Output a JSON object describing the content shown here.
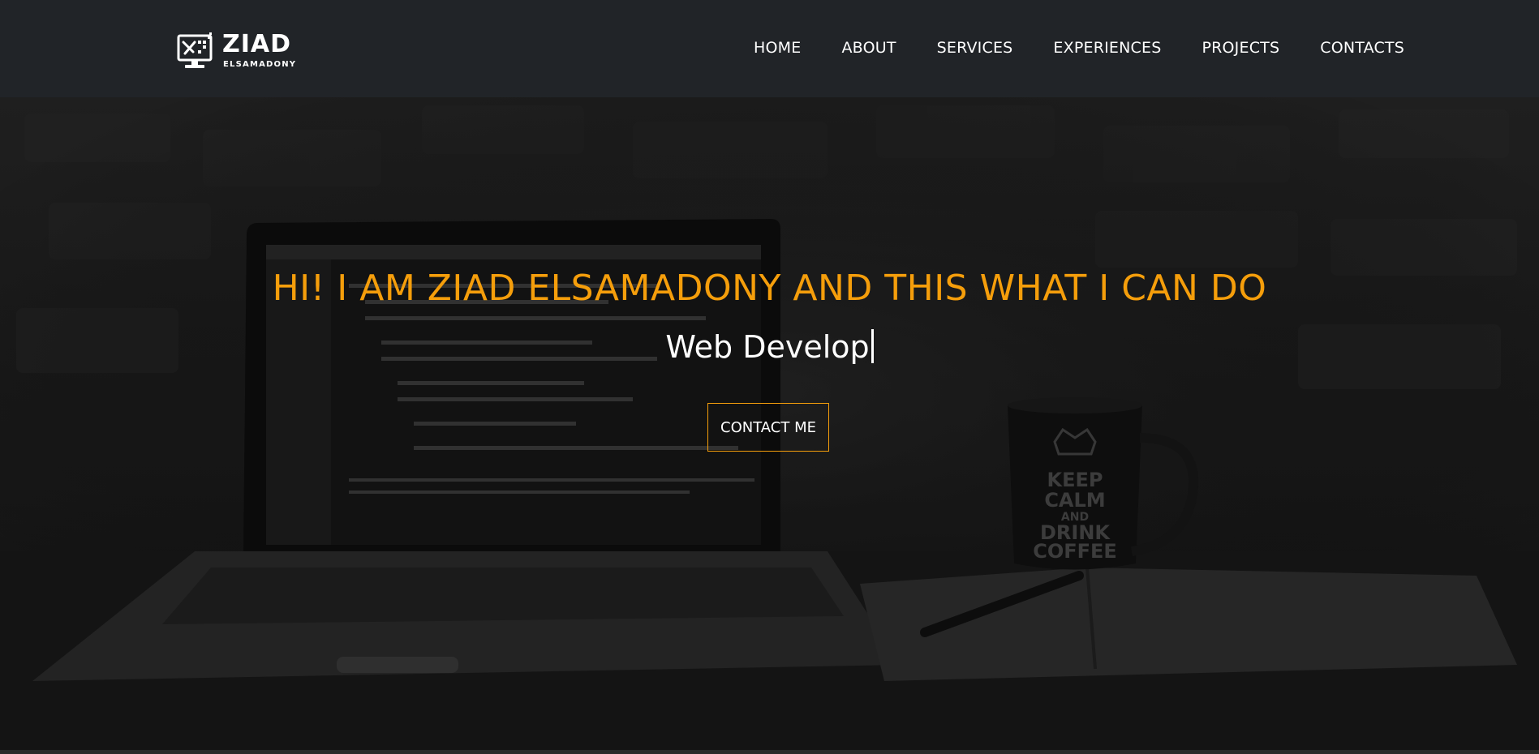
{
  "brand": {
    "name": "ZIAD",
    "subtitle": "ELSAMADONY",
    "logo_icon": "computer-tools-logo-icon"
  },
  "nav": {
    "items": [
      {
        "label": "HOME"
      },
      {
        "label": "ABOUT"
      },
      {
        "label": "SERVICES"
      },
      {
        "label": "EXPERIENCES"
      },
      {
        "label": "PROJECTS"
      },
      {
        "label": "CONTACTS"
      }
    ]
  },
  "hero": {
    "headline": "HI! I AM ZIAD ELSAMADONY AND THIS WHAT I CAN DO",
    "typed_text": "Web Develop",
    "cta_label": "CONTACT ME",
    "mug_text": [
      "KEEP",
      "CALM",
      "AND",
      "DRINK",
      "COFFEE"
    ]
  },
  "colors": {
    "navbar_bg": "#212428",
    "accent": "#f59e0b",
    "text": "#ffffff"
  }
}
